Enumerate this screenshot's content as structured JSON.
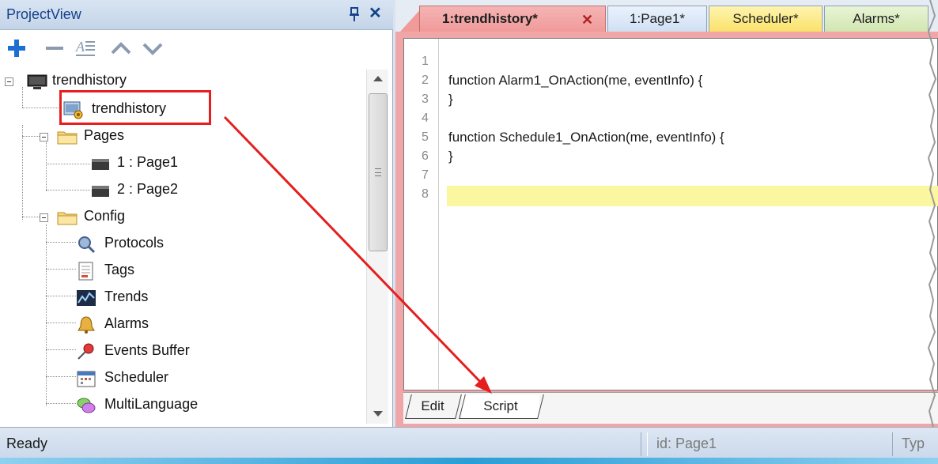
{
  "project_view": {
    "title": "ProjectView",
    "pin_glyph": "p",
    "close_glyph": "✕",
    "toolbar": [
      "add-icon",
      "remove-icon",
      "properties-icon",
      "move-up-icon",
      "move-down-icon"
    ],
    "tree": {
      "root": "trendhistory",
      "project_file": "trendhistory",
      "pages_folder": "Pages",
      "pages": [
        "1 : Page1",
        "2 : Page2"
      ],
      "config_folder": "Config",
      "config_items": [
        "Protocols",
        "Tags",
        "Trends",
        "Alarms",
        "Events Buffer",
        "Scheduler",
        "MultiLanguage"
      ]
    }
  },
  "editor": {
    "tabs": [
      {
        "label": "1:trendhistory*",
        "close": "✕"
      },
      {
        "label": "1:Page1*"
      },
      {
        "label": "Scheduler*"
      },
      {
        "label": "Alarms*"
      }
    ],
    "line_numbers": [
      "1",
      "2",
      "3",
      "4",
      "5",
      "6",
      "7",
      "8"
    ],
    "code": [
      "",
      "function Alarm1_OnAction(me, eventInfo) {",
      "}",
      "",
      "function Schedule1_OnAction(me, eventInfo) {",
      "}",
      "",
      ""
    ],
    "bottom_tabs": [
      "Edit",
      "Script"
    ]
  },
  "status_bar": {
    "status": "Ready",
    "id_text": "id:  Page1",
    "type_text": "Typ"
  },
  "colors": {
    "annotation": "#e51e1e",
    "active_tab": "#f19a9a",
    "scheduler_tab": "#f9e26a",
    "alarms_tab": "#d1e6b0",
    "page_tab": "#cfe0f4",
    "current_line": "#fbf6a0"
  }
}
